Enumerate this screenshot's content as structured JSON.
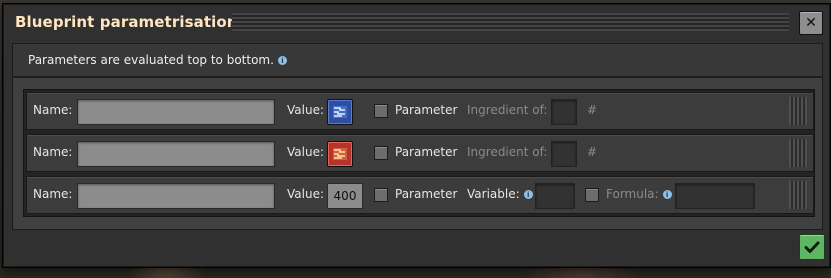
{
  "window": {
    "title": "Blueprint parametrisation",
    "close_icon": "close-icon"
  },
  "info": {
    "text": "Parameters are evaluated top to bottom.",
    "icon": "info-icon"
  },
  "rows": [
    {
      "name_label": "Name:",
      "name_value": "",
      "value_label": "Value:",
      "value_icon": "blue-circuit-icon",
      "parameter_label": "Parameter",
      "parameter_checked": false,
      "ingredient_label": "Ingredient of:",
      "hash_label": "#"
    },
    {
      "name_label": "Name:",
      "name_value": "",
      "value_label": "Value:",
      "value_icon": "red-circuit-icon",
      "parameter_label": "Parameter",
      "parameter_checked": false,
      "ingredient_label": "Ingredient of:",
      "hash_label": "#"
    },
    {
      "name_label": "Name:",
      "name_value": "",
      "value_label": "Value:",
      "value_number": "400",
      "parameter_label": "Parameter",
      "parameter_checked": false,
      "variable_label": "Variable:",
      "formula_label": "Formula:",
      "formula_checked": false
    }
  ],
  "confirm_icon": "checkmark-icon",
  "colors": {
    "title": "#ffe6c0",
    "confirm": "#5eb663",
    "blue_slot": "#2e4fa3",
    "red_slot": "#b8332a",
    "info_icon": "#8fc1e8"
  }
}
